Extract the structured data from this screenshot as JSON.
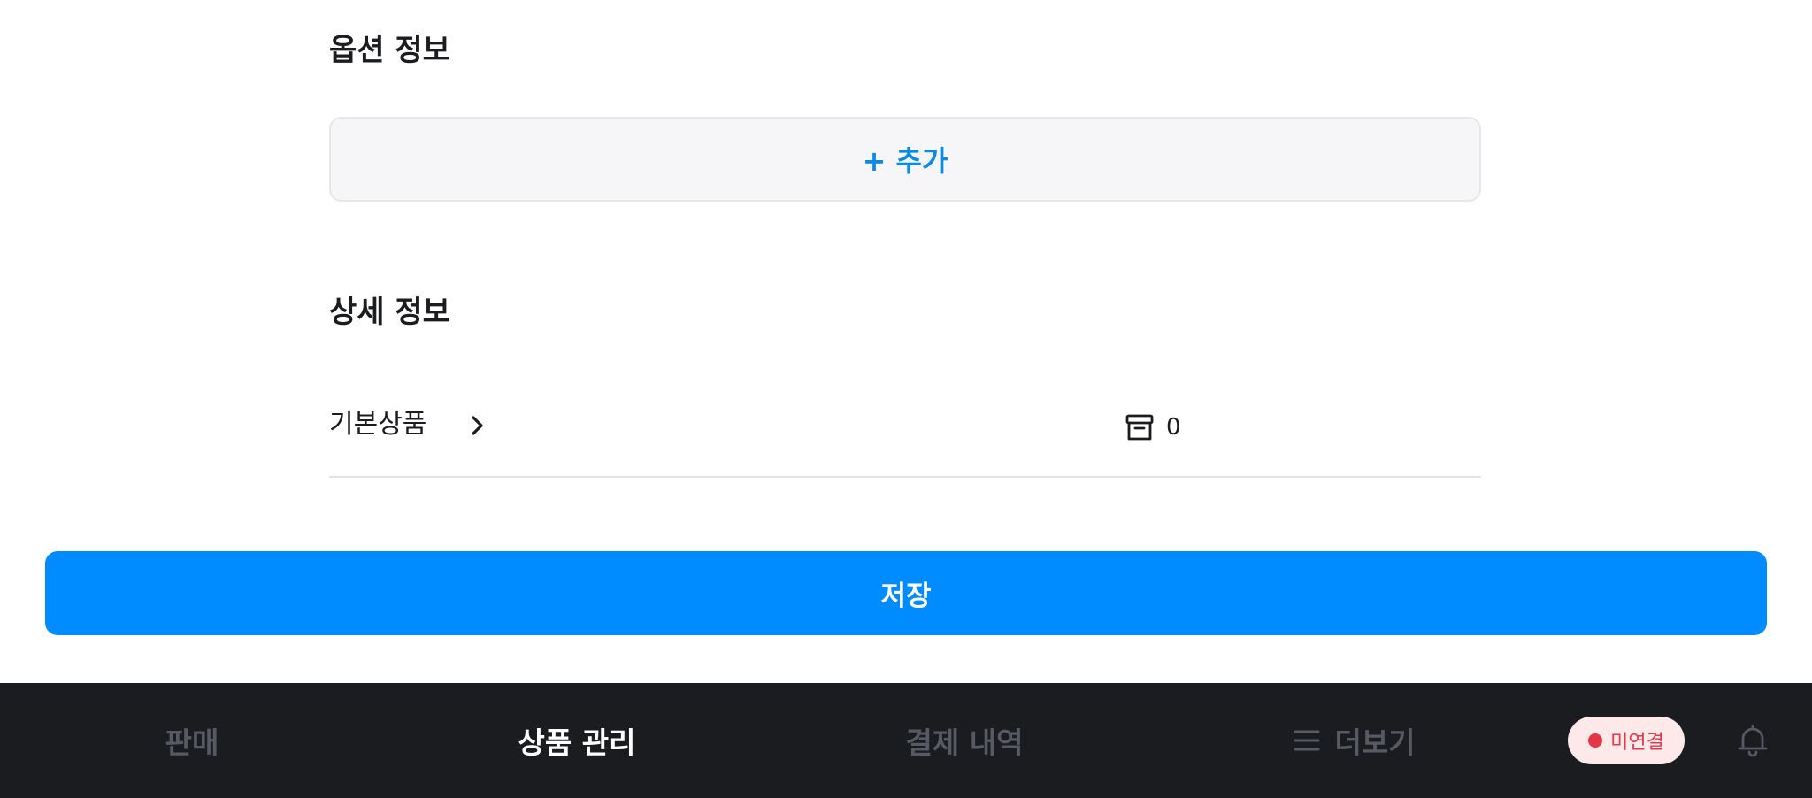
{
  "options_section": {
    "title": "옵션 정보",
    "add_button_label": "+ 추가"
  },
  "details_section": {
    "title": "상세 정보",
    "rows": [
      {
        "name": "기본상품",
        "icon": "archive-box-icon",
        "stock": "0"
      }
    ]
  },
  "save_button": {
    "label": "저장",
    "color": "#008cff"
  },
  "bottom_nav": {
    "items": [
      {
        "label": "판매",
        "active": false
      },
      {
        "label": "상품 관리",
        "active": true
      },
      {
        "label": "결제 내역",
        "active": false
      },
      {
        "label": "더보기",
        "active": false,
        "icon": "menu-icon"
      }
    ],
    "connection_status": {
      "label": "미연결",
      "color": "#e53645"
    },
    "notification_icon": "bell-icon"
  }
}
